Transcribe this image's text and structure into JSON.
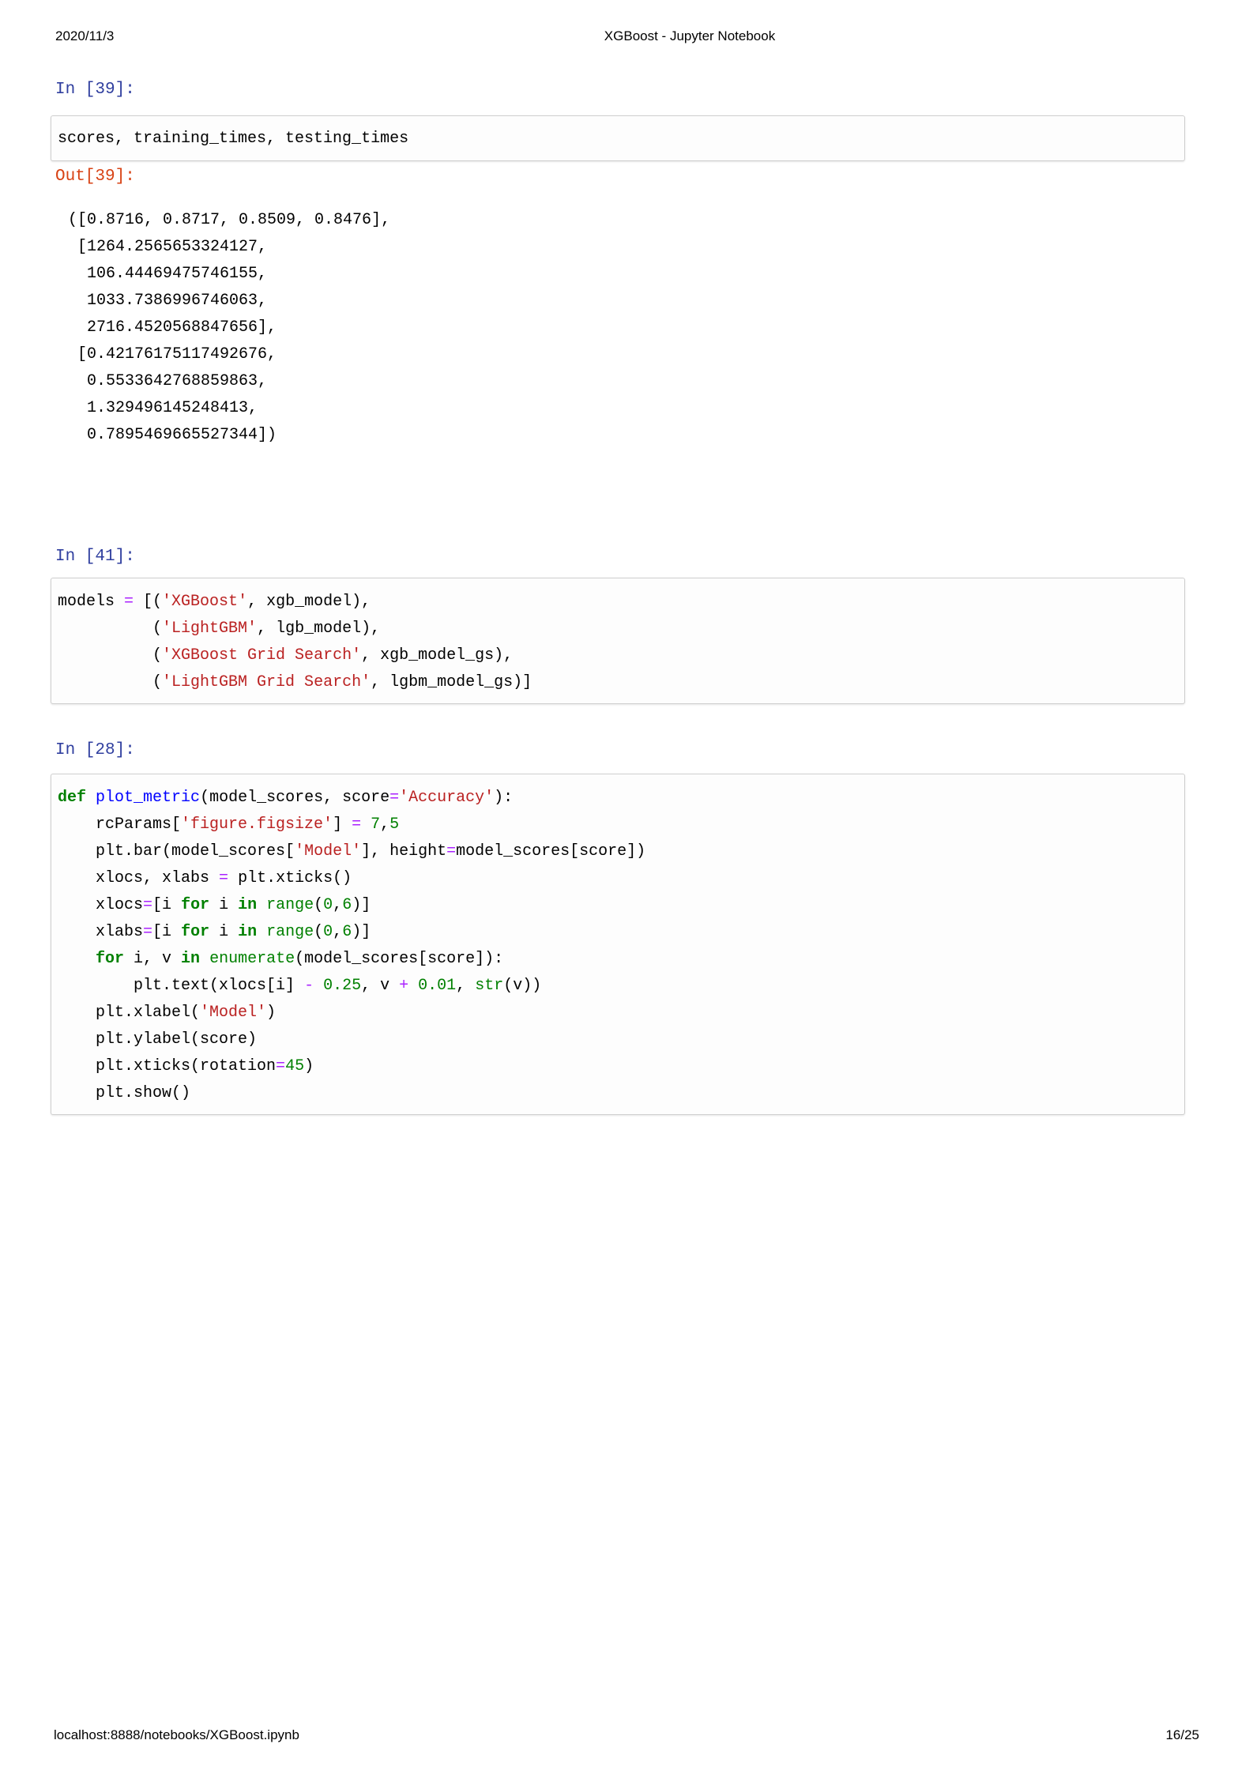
{
  "header": {
    "date": "2020/11/3",
    "title": "XGBoost - Jupyter Notebook"
  },
  "footer": {
    "url": "localhost:8888/notebooks/XGBoost.ipynb",
    "page_number": "16/25"
  },
  "colors": {
    "in_prompt": "#303F9F",
    "out_prompt": "#D84315",
    "keyword": "#008000",
    "string": "#BA2121",
    "number": "#008000",
    "operator": "#AA22FF",
    "function_name": "#0000FF",
    "cell_border": "#cfcfcf"
  },
  "cells": {
    "in39": {
      "prompt": "In [39]:",
      "lines": [
        [
          [
            "scores, training_times, testing_times",
            ""
          ]
        ]
      ]
    },
    "out39": {
      "prompt": "Out[39]:",
      "lines": [
        "([0.8716, 0.8717, 0.8509, 0.8476],",
        " [1264.2565653324127,",
        "  106.44469475746155,",
        "  1033.7386996746063,",
        "  2716.4520568847656],",
        " [0.42176175117492676,",
        "  0.5533642768859863,",
        "  1.329496145248413,",
        "  0.7895469665527344])"
      ]
    },
    "in41": {
      "prompt": "In [41]:",
      "lines": [
        [
          [
            "models ",
            ""
          ],
          [
            "=",
            "o"
          ],
          [
            " [(",
            ""
          ],
          [
            "'XGBoost'",
            "s"
          ],
          [
            ", xgb_model),",
            ""
          ]
        ],
        [
          [
            "          (",
            ""
          ],
          [
            "'LightGBM'",
            "s"
          ],
          [
            ", lgb_model),",
            ""
          ]
        ],
        [
          [
            "          (",
            ""
          ],
          [
            "'XGBoost Grid Search'",
            "s"
          ],
          [
            ", xgb_model_gs),",
            ""
          ]
        ],
        [
          [
            "          (",
            ""
          ],
          [
            "'LightGBM Grid Search'",
            "s"
          ],
          [
            ", lgbm_model_gs)]",
            ""
          ]
        ]
      ]
    },
    "in28": {
      "prompt": "In [28]:",
      "lines": [
        [
          [
            "def",
            "k"
          ],
          [
            " ",
            ""
          ],
          [
            "plot_metric",
            "f"
          ],
          [
            "(model_scores, score",
            ""
          ],
          [
            "=",
            "o"
          ],
          [
            "'Accuracy'",
            "s"
          ],
          [
            "):",
            ""
          ]
        ],
        [
          [
            "    rcParams[",
            ""
          ],
          [
            "'figure.figsize'",
            "s"
          ],
          [
            "] ",
            ""
          ],
          [
            "=",
            "o"
          ],
          [
            " ",
            ""
          ],
          [
            "7",
            "n"
          ],
          [
            ",",
            ""
          ],
          [
            "5",
            "n"
          ]
        ],
        [
          [
            "    plt.bar(model_scores[",
            ""
          ],
          [
            "'Model'",
            "s"
          ],
          [
            "], height",
            ""
          ],
          [
            "=",
            "o"
          ],
          [
            "model_scores[score])",
            ""
          ]
        ],
        [
          [
            "    xlocs, xlabs ",
            ""
          ],
          [
            "=",
            "o"
          ],
          [
            " plt.xticks()",
            ""
          ]
        ],
        [
          [
            "    xlocs",
            ""
          ],
          [
            "=",
            "o"
          ],
          [
            "[i ",
            ""
          ],
          [
            "for",
            "k"
          ],
          [
            " i ",
            ""
          ],
          [
            "in",
            "k"
          ],
          [
            " ",
            ""
          ],
          [
            "range",
            "b"
          ],
          [
            "(",
            ""
          ],
          [
            "0",
            "n"
          ],
          [
            ",",
            ""
          ],
          [
            "6",
            "n"
          ],
          [
            ")]",
            ""
          ]
        ],
        [
          [
            "    xlabs",
            ""
          ],
          [
            "=",
            "o"
          ],
          [
            "[i ",
            ""
          ],
          [
            "for",
            "k"
          ],
          [
            " i ",
            ""
          ],
          [
            "in",
            "k"
          ],
          [
            " ",
            ""
          ],
          [
            "range",
            "b"
          ],
          [
            "(",
            ""
          ],
          [
            "0",
            "n"
          ],
          [
            ",",
            ""
          ],
          [
            "6",
            "n"
          ],
          [
            ")]",
            ""
          ]
        ],
        [
          [
            "    ",
            ""
          ],
          [
            "for",
            "k"
          ],
          [
            " i, v ",
            ""
          ],
          [
            "in",
            "k"
          ],
          [
            " ",
            ""
          ],
          [
            "enumerate",
            "b"
          ],
          [
            "(model_scores[score]):",
            ""
          ]
        ],
        [
          [
            "        plt.text(xlocs[i] ",
            ""
          ],
          [
            "-",
            "o"
          ],
          [
            " ",
            ""
          ],
          [
            "0.25",
            "n"
          ],
          [
            ", v ",
            ""
          ],
          [
            "+",
            "o"
          ],
          [
            " ",
            ""
          ],
          [
            "0.01",
            "n"
          ],
          [
            ", ",
            ""
          ],
          [
            "str",
            "b"
          ],
          [
            "(v))",
            ""
          ]
        ],
        [
          [
            "    plt.xlabel(",
            ""
          ],
          [
            "'Model'",
            "s"
          ],
          [
            ")",
            ""
          ]
        ],
        [
          [
            "    plt.ylabel(score)",
            ""
          ]
        ],
        [
          [
            "    plt.xticks(rotation",
            ""
          ],
          [
            "=",
            "o"
          ],
          [
            "45",
            "n"
          ],
          [
            ")",
            ""
          ]
        ],
        [
          [
            "    plt.show()",
            ""
          ]
        ]
      ]
    }
  }
}
